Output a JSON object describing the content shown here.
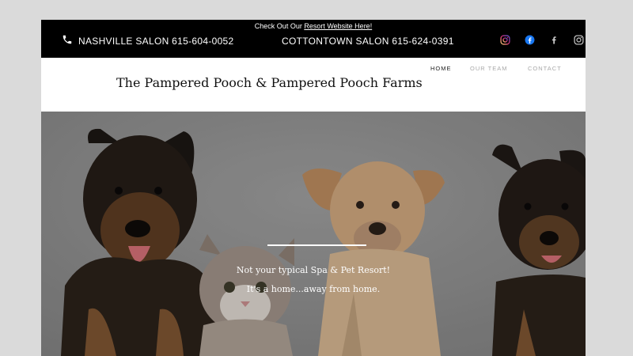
{
  "announcement": {
    "prefix": "Check Out Our ",
    "link": "Resort Website Here!"
  },
  "contacts": {
    "nashville": "NASHVILLE SALON 615-604-0052",
    "cottontown": "COTTONTOWN SALON 615-624-0391"
  },
  "social": [
    {
      "icon": "instagram-icon",
      "color": "#e1306c"
    },
    {
      "icon": "facebook-icon",
      "color": "#1877f2"
    },
    {
      "icon": "facebook-f-icon",
      "color": "#cccccc"
    },
    {
      "icon": "instagram-icon",
      "color": "#cccccc"
    }
  ],
  "brand": {
    "title": "The Pampered Pooch & Pampered Pooch Farms"
  },
  "nav": {
    "items": [
      {
        "label": "HOME",
        "active": true
      },
      {
        "label": "OUR TEAM",
        "active": false
      },
      {
        "label": "CONTACT",
        "active": false
      }
    ]
  },
  "hero": {
    "line1": "Not your typical Spa & Pet Resort!",
    "line2": "It's a home...away from home."
  }
}
